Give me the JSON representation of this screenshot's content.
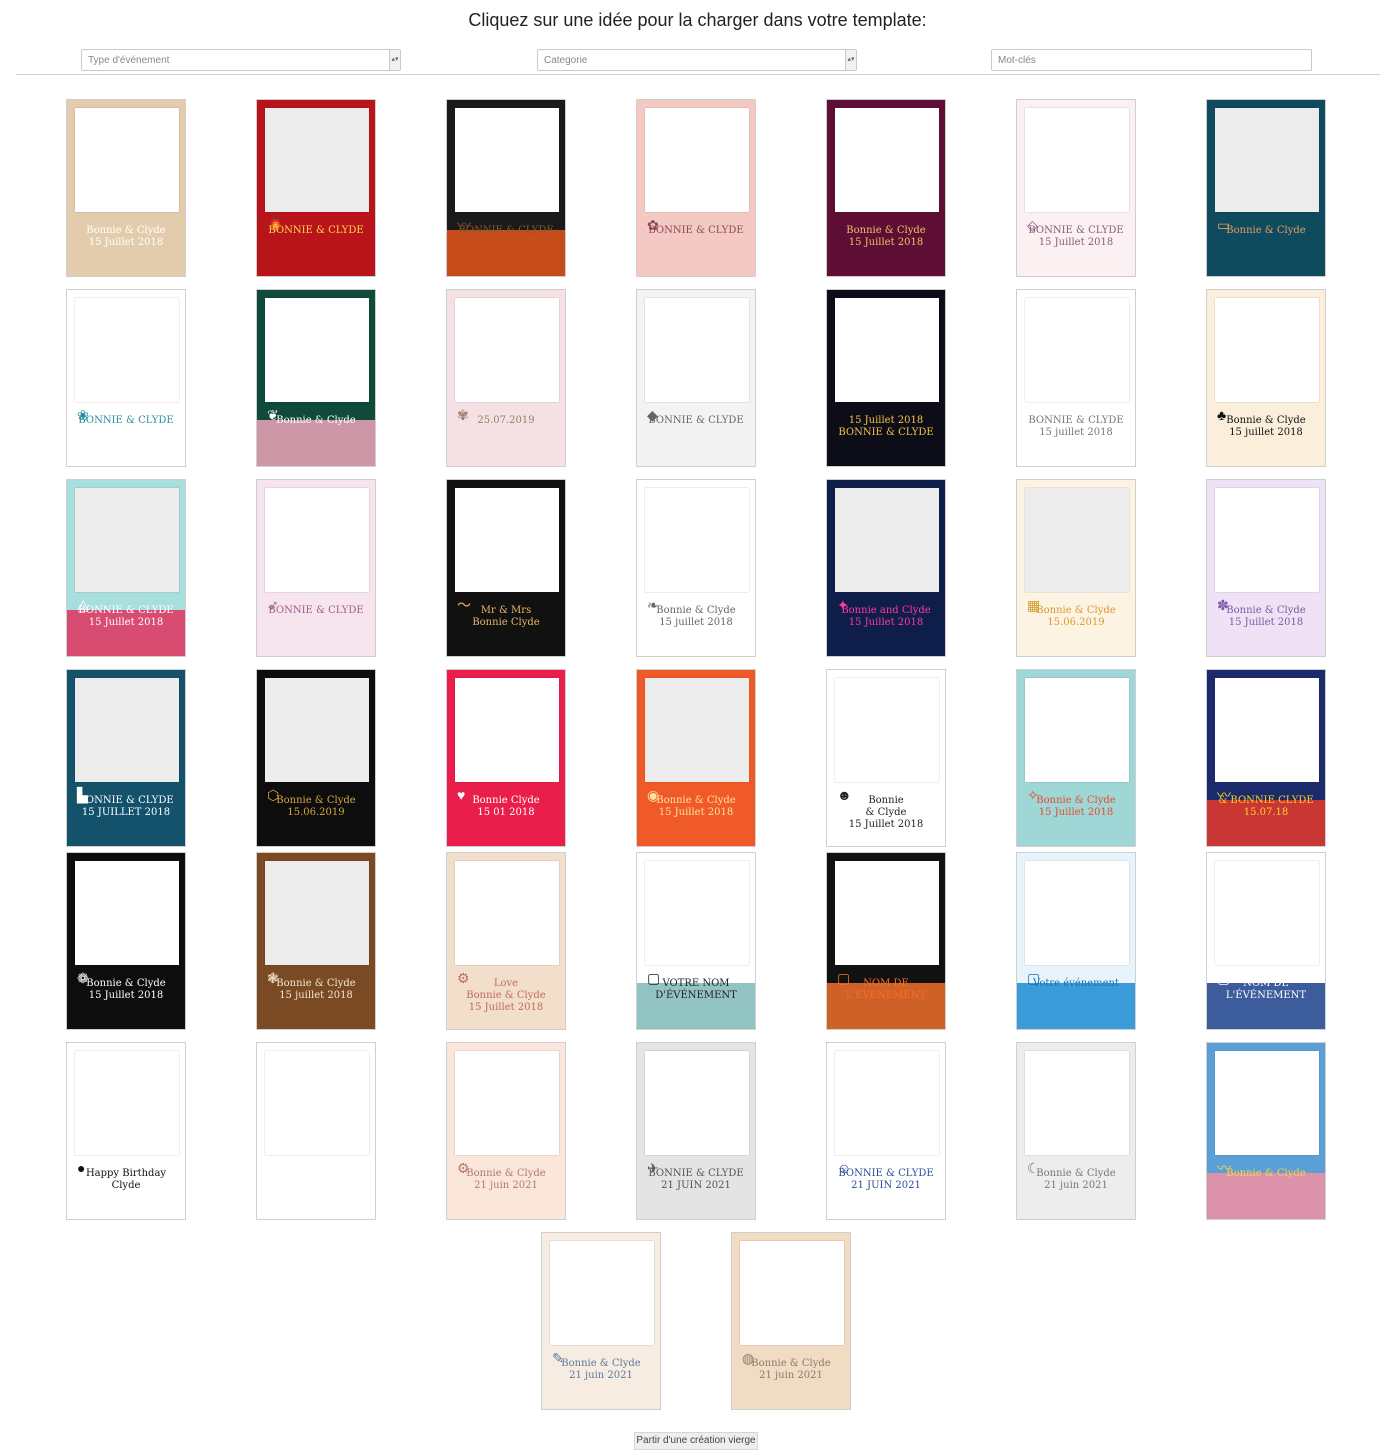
{
  "header": {
    "title": "Cliquez sur une idée pour la charger dans votre template:"
  },
  "filters": {
    "event_type": "Type d'événement",
    "category": "Categorie",
    "keywords_placeholder": "Mot-clés"
  },
  "templates": [
    {
      "text": "Bonnie & Clyde\n15 Juillet 2018",
      "bg": "#e3ccab",
      "fg": "#ffffff",
      "photo": "white",
      "icon": ""
    },
    {
      "text": "BONNIE & CLYDE",
      "bg": "#b9141a",
      "fg": "#ffd54f",
      "photo": "grey",
      "icon": "lantern-icon"
    },
    {
      "text": "BONNIE & CLYDE",
      "bg": "#1a1a1a",
      "fg": "#8a5a2b",
      "photo": "white",
      "icon": "wave-icon",
      "accent": "#e5561d"
    },
    {
      "text": "BONNIE & CLYDE",
      "bg": "#f4c9c3",
      "fg": "#8b4a5a",
      "photo": "white",
      "icon": "blossom-icon"
    },
    {
      "text": "Bonnie & Clyde\n15 Juillet 2018",
      "bg": "#5e0d35",
      "fg": "#f2c063",
      "photo": "white",
      "icon": ""
    },
    {
      "text": "BONNIE & CLYDE\n15 Juillet 2018",
      "bg": "#fbf1f3",
      "fg": "#8b5b7a",
      "photo": "white",
      "icon": "pattern-icon"
    },
    {
      "text": "Bonnie & Clyde",
      "bg": "#0f4a5f",
      "fg": "#e0a060",
      "photo": "grey",
      "icon": "frame-icon"
    },
    {
      "text": "BONNIE & CLYDE",
      "bg": "#ffffff",
      "fg": "#2a8fa5",
      "photo": "white",
      "icon": "wreath-icon"
    },
    {
      "text": "Bonnie & Clyde",
      "bg": "#0f4a3a",
      "fg": "#ffffff",
      "photo": "white",
      "icon": "leaf-icon",
      "accent": "#f0a5bc"
    },
    {
      "text": "25.07.2019",
      "bg": "#f5e1e3",
      "fg": "#9c7a6a",
      "photo": "white",
      "icon": "flower-icon"
    },
    {
      "text": "BONNIE & CLYDE",
      "bg": "#f3f3f3",
      "fg": "#666666",
      "photo": "white",
      "icon": "diamond-icon"
    },
    {
      "text": "15 Juillet 2018\nBONNIE & CLYDE",
      "bg": "#0d0d1a",
      "fg": "#f3c53d",
      "photo": "white",
      "icon": ""
    },
    {
      "text": "BONNIE & CLYDE\n15 juillet 2018",
      "bg": "#ffffff",
      "fg": "#777777",
      "photo": "white",
      "icon": ""
    },
    {
      "text": "Bonnie & Clyde\n15 juillet 2018",
      "bg": "#fbefdc",
      "fg": "#111111",
      "photo": "white",
      "icon": "palm-icon"
    },
    {
      "text": "BONNIE & CLYDE\n15 Juillet 2018",
      "bg": "#a9dede",
      "fg": "#ffffff",
      "photo": "grey",
      "icon": "eiffel-icon",
      "accent": "#e0325e"
    },
    {
      "text": "BONNIE & CLYDE",
      "bg": "#f6e4ef",
      "fg": "#a45a88",
      "photo": "white",
      "icon": "feather-icon"
    },
    {
      "text": "Mr & Mrs\nBonnie  Clyde",
      "bg": "#111111",
      "fg": "#e8b566",
      "photo": "white",
      "icon": "moustache-icon"
    },
    {
      "text": "Bonnie & Clyde\n15 juillet 2018",
      "bg": "#ffffff",
      "fg": "#666666",
      "photo": "white",
      "icon": "vine-icon"
    },
    {
      "text": "Bonnie and Clyde\n15 Juillet 2018",
      "bg": "#0f1d4a",
      "fg": "#ff3a9a",
      "photo": "grey",
      "icon": "neon-icon"
    },
    {
      "text": "Bonnie & Clyde\n15.06.2019",
      "bg": "#fdf3e3",
      "fg": "#d79b2d",
      "photo": "grey",
      "icon": "tribal-icon"
    },
    {
      "text": "Bonnie & Clyde\n15 Juillet 2018",
      "bg": "#efe2f6",
      "fg": "#7b5aa6",
      "photo": "white",
      "icon": "watercolor-icon"
    },
    {
      "text": "BONNIE & CLYDE\n15 JUILLET 2018",
      "bg": "#14516a",
      "fg": "#ffffff",
      "photo": "grey",
      "icon": "skyline-icon"
    },
    {
      "text": "Bonnie & Clyde\n15.06.2019",
      "bg": "#0d0d0d",
      "fg": "#d8a63e",
      "photo": "grey",
      "icon": "hexagon-icon"
    },
    {
      "text": "Bonnie Clyde\n15 01 2018",
      "bg": "#e91e4b",
      "fg": "#ffffff",
      "photo": "white",
      "icon": "heart-icon"
    },
    {
      "text": "Bonnie & Clyde\n15 Juillet 2018",
      "bg": "#f05a28",
      "fg": "#ffe0a0",
      "photo": "grey",
      "icon": "badge-icon"
    },
    {
      "text": "Bonnie\n& Clyde\n15 Juillet 2018",
      "bg": "#ffffff",
      "fg": "#222222",
      "photo": "white",
      "icon": "wolf-icon"
    },
    {
      "text": "Bonnie & Clyde\n15 Juillet 2018",
      "bg": "#9fd6d6",
      "fg": "#e44d2e",
      "photo": "white",
      "icon": "fox-icon"
    },
    {
      "text": "& BONNIE CLYDE\n15.07.18",
      "bg": "#1b2a6b",
      "fg": "#ffd21f",
      "photo": "white",
      "icon": "wave-icon",
      "accent": "#e63a2a"
    },
    {
      "text": "Bonnie & Clyde\n15 Juillet 2018",
      "bg": "#0d0d0d",
      "fg": "#ffffff",
      "photo": "white",
      "icon": "bouquet-icon"
    },
    {
      "text": "Bonnie & Clyde\n15 juillet 2018",
      "bg": "#7a4a24",
      "fg": "#f4e6d0",
      "photo": "grey",
      "icon": "lace-icon"
    },
    {
      "text": "Love\nBonnie & Clyde\n15 Juillet 2018",
      "bg": "#f1dfcc",
      "fg": "#c26b5a",
      "photo": "white",
      "icon": "bicycle-icon"
    },
    {
      "text": "VOTRE NOM D'ÉVÉNEMENT",
      "bg": "#ffffff",
      "fg": "#222222",
      "photo": "white",
      "icon": "logo-icon",
      "accent": "#7fb9b9"
    },
    {
      "text": "NOM DE L'ÉVÉNEMENT",
      "bg": "#111111",
      "fg": "#f2702a",
      "photo": "white",
      "icon": "logo-icon",
      "accent": "#f2702a"
    },
    {
      "text": "Votre événement",
      "bg": "#e8f4fb",
      "fg": "#1a6fb0",
      "photo": "white",
      "icon": "logo-icon",
      "accent": "#1c8ad1"
    },
    {
      "text": "NOM DE L'ÉVÉNEMENT",
      "bg": "#ffffff",
      "fg": "#ffffff",
      "photo": "white",
      "icon": "logo-icon",
      "accent": "#1a3f8a"
    },
    {
      "text": "Happy Birthday Clyde",
      "bg": "#ffffff",
      "fg": "#111111",
      "photo": "white",
      "icon": "balloon-icon"
    },
    {
      "text": "",
      "bg": "#ffffff",
      "fg": "#999999",
      "photo": "white",
      "icon": ""
    },
    {
      "text": "Bonnie & Clyde\n21 juin 2021",
      "bg": "#fbe6dc",
      "fg": "#b07a6a",
      "photo": "white",
      "icon": "bicycle-icon"
    },
    {
      "text": "BONNIE & CLYDE\n21 JUIN 2021",
      "bg": "#e4e4e4",
      "fg": "#555555",
      "photo": "white",
      "icon": "plane-icon"
    },
    {
      "text": "BONNIE & CLYDE\n21 JUIN 2021",
      "bg": "#ffffff",
      "fg": "#2a4d9a",
      "photo": "white",
      "icon": "figure-icon"
    },
    {
      "text": "Bonnie & Clyde\n21 juin 2021",
      "bg": "#ededed",
      "fg": "#777777",
      "photo": "white",
      "icon": "moon-icon"
    },
    {
      "text": "Bonnie & Clyde",
      "bg": "#5aa0d6",
      "fg": "#ffd33a",
      "photo": "white",
      "icon": "wave-icon",
      "accent": "#f48fa3"
    },
    {
      "text": "Bonnie & Clyde\n21 juin 2021",
      "bg": "#f7ece1",
      "fg": "#5a7a9a",
      "photo": "white",
      "icon": "doodle-icon"
    },
    {
      "text": "Bonnie & Clyde\n21 juin 2021",
      "bg": "#efdcc3",
      "fg": "#8a7a6a",
      "photo": "white",
      "icon": "world-map-icon"
    }
  ],
  "footer": {
    "blank_button": "Partir d'une création vierge"
  }
}
